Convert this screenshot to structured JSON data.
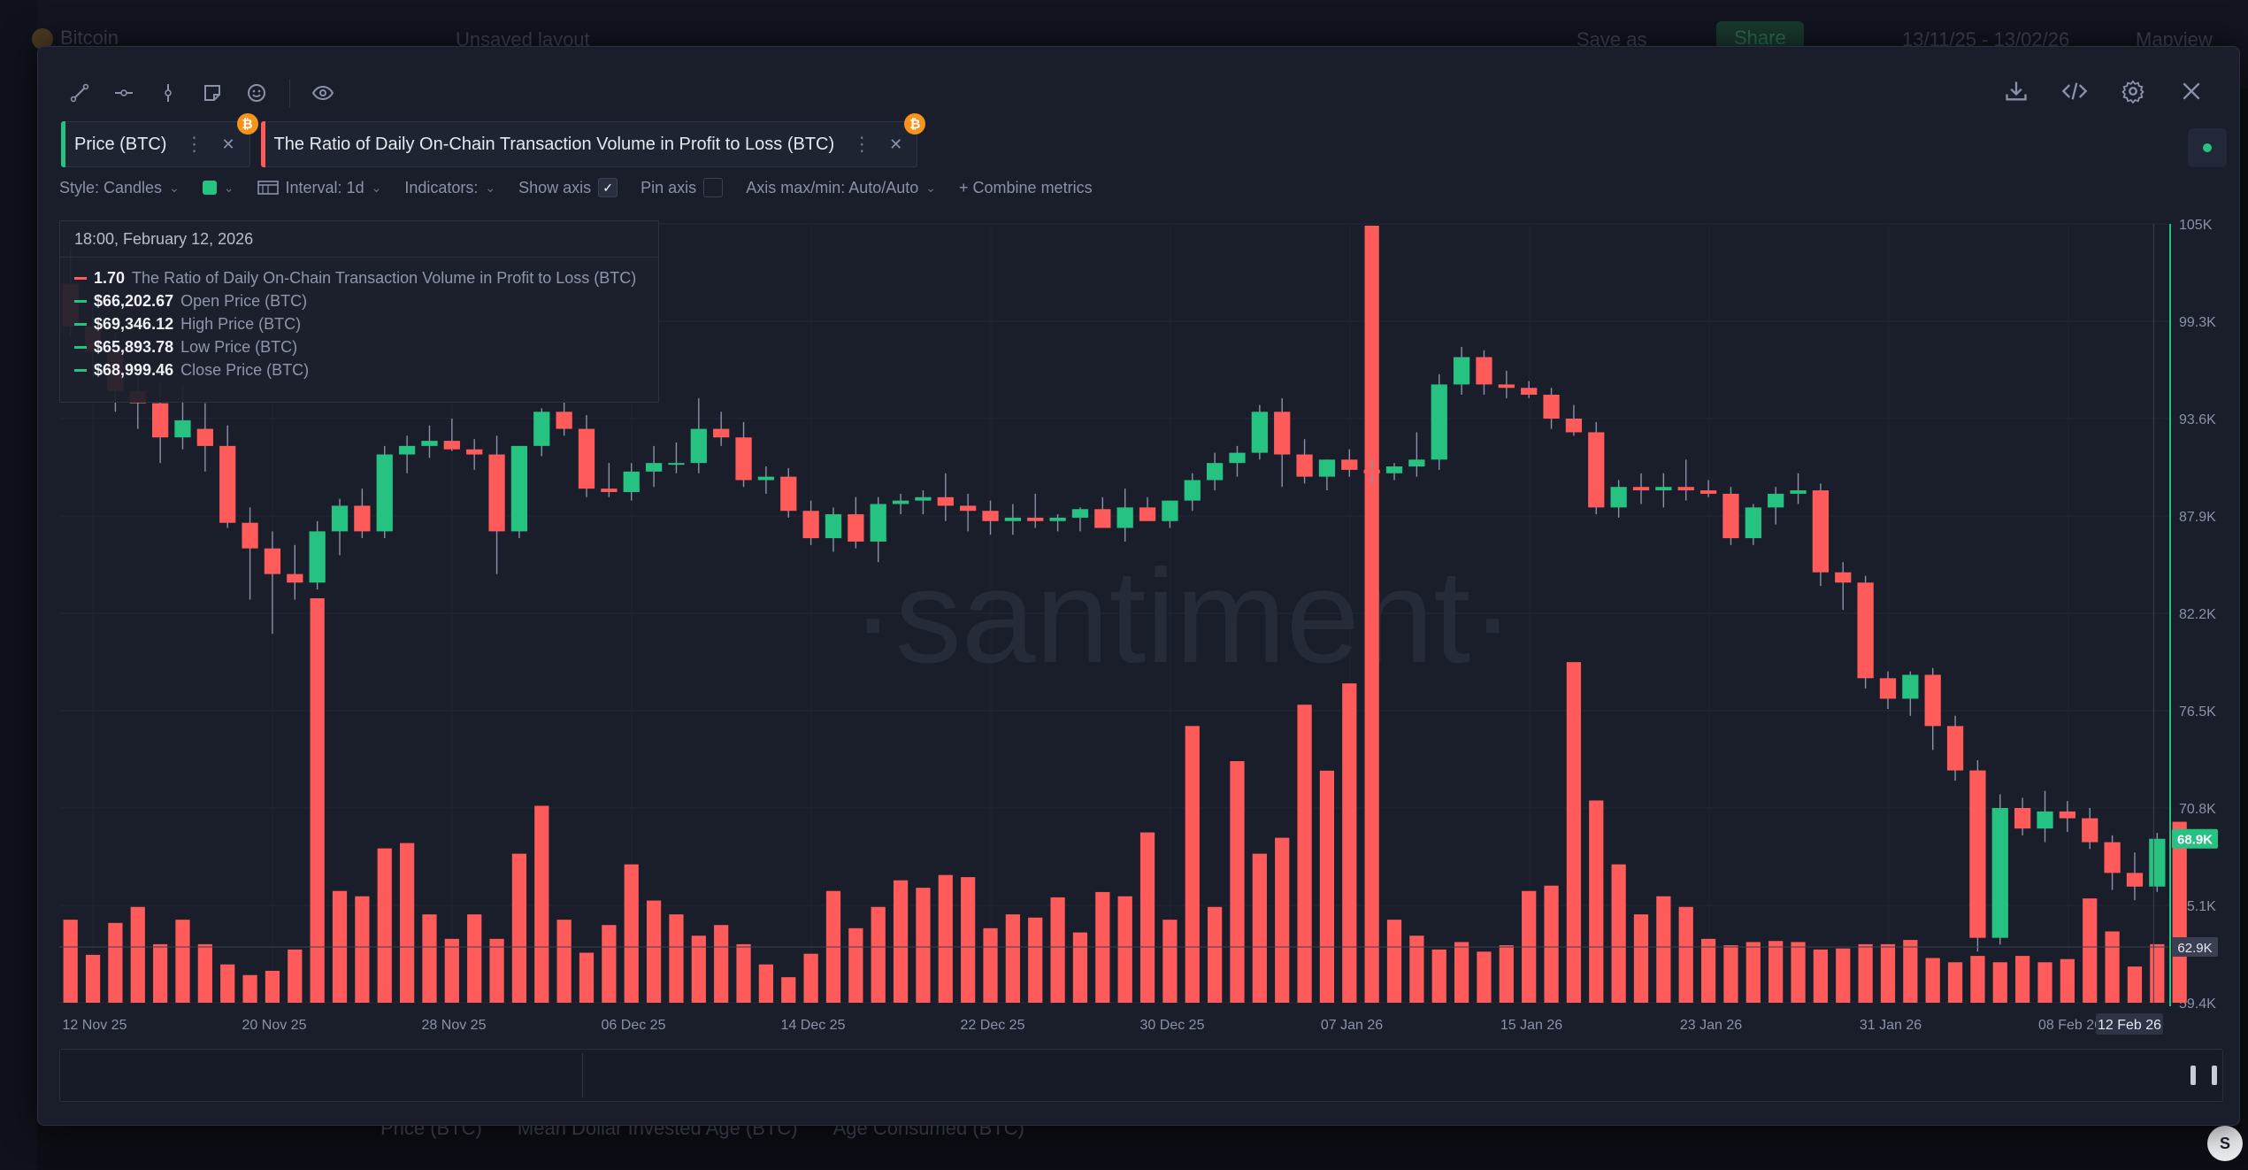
{
  "background": {
    "asset": "Bitcoin",
    "layout_title": "Unsaved layout",
    "save_as": "Save as",
    "share": "Share",
    "date_range": "13/11/25 - 13/02/26",
    "mapview": "Mapview",
    "bottom_tabs": [
      "Price (BTC)",
      "Mean Dollar Invested Age (BTC)",
      "Age Consumed (BTC)"
    ]
  },
  "toolbar": {
    "left_icons": [
      "trendline-icon",
      "horizontal-line-icon",
      "vertical-line-icon",
      "note-icon",
      "emoji-icon",
      "eye-icon"
    ],
    "right_icons": [
      "download-icon",
      "embed-code-icon",
      "settings-icon",
      "close-icon"
    ]
  },
  "metrics": [
    {
      "label": "Price (BTC)",
      "color": "#26c281"
    },
    {
      "label": "The Ratio of Daily On-Chain Transaction Volume in Profit to Loss (BTC)",
      "color": "#ff5b5b"
    }
  ],
  "settings": {
    "style": "Style: Candles",
    "interval": "Interval: 1d",
    "indicators": "Indicators:",
    "show_axis": "Show axis",
    "show_axis_checked": true,
    "pin_axis": "Pin axis",
    "pin_axis_checked": false,
    "axis_maxmin": "Axis max/min: Auto/Auto",
    "combine": "+ Combine metrics"
  },
  "tooltip": {
    "date": "18:00, February 12, 2026",
    "rows": [
      {
        "value": "1.70",
        "label": "The Ratio of Daily On-Chain Transaction Volume in Profit to Loss (BTC)",
        "color": "#ff5b5b"
      },
      {
        "value": "$66,202.67",
        "label": "Open Price (BTC)",
        "color": "#26c281"
      },
      {
        "value": "$69,346.12",
        "label": "High Price (BTC)",
        "color": "#26c281"
      },
      {
        "value": "$65,893.78",
        "label": "Low Price (BTC)",
        "color": "#26c281"
      },
      {
        "value": "$68,999.46",
        "label": "Close Price (BTC)",
        "color": "#26c281"
      }
    ]
  },
  "watermark": "·santiment·",
  "chart_data": {
    "type": "candlestick+bar",
    "y_ticks": [
      "105K",
      "99.3K",
      "93.6K",
      "87.9K",
      "82.2K",
      "76.5K",
      "70.8K",
      "65.1K",
      "59.4K"
    ],
    "y_range": [
      59400,
      105000
    ],
    "current_price_label": "68.9K",
    "ratio_marker_label": "62.9K",
    "x_ticks": [
      "12 Nov 25",
      "20 Nov 25",
      "28 Nov 25",
      "06 Dec 25",
      "14 Dec 25",
      "22 Dec 25",
      "30 Dec 25",
      "07 Jan 26",
      "15 Jan 26",
      "23 Jan 26",
      "31 Jan 26",
      "08 Feb 26",
      "12 Feb 26"
    ],
    "colors": {
      "up": "#26c281",
      "down": "#ff5b5b",
      "ratio": "#ff5b5b"
    },
    "candles": [
      {
        "o": 101500,
        "h": 103500,
        "l": 98400,
        "c": 99000
      },
      {
        "o": 99000,
        "h": 100200,
        "l": 96000,
        "c": 97500
      },
      {
        "o": 97500,
        "h": 98600,
        "l": 94000,
        "c": 95200
      },
      {
        "o": 95200,
        "h": 96500,
        "l": 93000,
        "c": 94500
      },
      {
        "o": 94500,
        "h": 95800,
        "l": 91000,
        "c": 92500
      },
      {
        "o": 92500,
        "h": 95500,
        "l": 91800,
        "c": 93500
      },
      {
        "o": 93000,
        "h": 94500,
        "l": 90500,
        "c": 92000
      },
      {
        "o": 92000,
        "h": 93200,
        "l": 87200,
        "c": 87500
      },
      {
        "o": 87500,
        "h": 88400,
        "l": 83000,
        "c": 86000
      },
      {
        "o": 86000,
        "h": 87000,
        "l": 81000,
        "c": 84500
      },
      {
        "o": 84500,
        "h": 86200,
        "l": 83000,
        "c": 84000
      },
      {
        "o": 84000,
        "h": 87600,
        "l": 83600,
        "c": 87000
      },
      {
        "o": 87000,
        "h": 88900,
        "l": 85600,
        "c": 88500
      },
      {
        "o": 88500,
        "h": 89500,
        "l": 86600,
        "c": 87000
      },
      {
        "o": 87000,
        "h": 92000,
        "l": 86600,
        "c": 91500
      },
      {
        "o": 91500,
        "h": 92600,
        "l": 90400,
        "c": 92000
      },
      {
        "o": 92000,
        "h": 93200,
        "l": 91300,
        "c": 92300
      },
      {
        "o": 92300,
        "h": 93600,
        "l": 91700,
        "c": 91800
      },
      {
        "o": 91800,
        "h": 92400,
        "l": 90600,
        "c": 91500
      },
      {
        "o": 91500,
        "h": 92600,
        "l": 84500,
        "c": 87000
      },
      {
        "o": 87000,
        "h": 92000,
        "l": 86600,
        "c": 92000
      },
      {
        "o": 92000,
        "h": 94200,
        "l": 91400,
        "c": 94000
      },
      {
        "o": 94000,
        "h": 94800,
        "l": 92600,
        "c": 93000
      },
      {
        "o": 93000,
        "h": 93800,
        "l": 89000,
        "c": 89500
      },
      {
        "o": 89500,
        "h": 91000,
        "l": 89000,
        "c": 89300
      },
      {
        "o": 89300,
        "h": 91000,
        "l": 88800,
        "c": 90500
      },
      {
        "o": 90500,
        "h": 92000,
        "l": 89600,
        "c": 91000
      },
      {
        "o": 91000,
        "h": 92200,
        "l": 90400,
        "c": 91000
      },
      {
        "o": 91000,
        "h": 94800,
        "l": 90400,
        "c": 93000
      },
      {
        "o": 93000,
        "h": 94000,
        "l": 92000,
        "c": 92500
      },
      {
        "o": 92500,
        "h": 93400,
        "l": 89600,
        "c": 90000
      },
      {
        "o": 90000,
        "h": 90800,
        "l": 89200,
        "c": 90200
      },
      {
        "o": 90200,
        "h": 90700,
        "l": 87800,
        "c": 88200
      },
      {
        "o": 88200,
        "h": 88800,
        "l": 86200,
        "c": 86600
      },
      {
        "o": 86600,
        "h": 88400,
        "l": 85800,
        "c": 88000
      },
      {
        "o": 88000,
        "h": 89000,
        "l": 86000,
        "c": 86400
      },
      {
        "o": 86400,
        "h": 89000,
        "l": 85200,
        "c": 88600
      },
      {
        "o": 88600,
        "h": 89200,
        "l": 88000,
        "c": 88800
      },
      {
        "o": 88800,
        "h": 89400,
        "l": 88000,
        "c": 89000
      },
      {
        "o": 89000,
        "h": 90400,
        "l": 87600,
        "c": 88500
      },
      {
        "o": 88500,
        "h": 89200,
        "l": 87000,
        "c": 88200
      },
      {
        "o": 88200,
        "h": 88800,
        "l": 86800,
        "c": 87600
      },
      {
        "o": 87600,
        "h": 88600,
        "l": 86800,
        "c": 87800
      },
      {
        "o": 87800,
        "h": 89200,
        "l": 87200,
        "c": 87600
      },
      {
        "o": 87600,
        "h": 88000,
        "l": 87000,
        "c": 87800
      },
      {
        "o": 87800,
        "h": 88400,
        "l": 87000,
        "c": 88300
      },
      {
        "o": 88300,
        "h": 89000,
        "l": 87400,
        "c": 87200
      },
      {
        "o": 87200,
        "h": 89500,
        "l": 86400,
        "c": 88400
      },
      {
        "o": 88400,
        "h": 89000,
        "l": 87800,
        "c": 87600
      },
      {
        "o": 87600,
        "h": 88800,
        "l": 87200,
        "c": 88800
      },
      {
        "o": 88800,
        "h": 90400,
        "l": 88200,
        "c": 90000
      },
      {
        "o": 90000,
        "h": 91600,
        "l": 89400,
        "c": 91000
      },
      {
        "o": 91000,
        "h": 92000,
        "l": 90200,
        "c": 91600
      },
      {
        "o": 91600,
        "h": 94400,
        "l": 91200,
        "c": 94000
      },
      {
        "o": 94000,
        "h": 94800,
        "l": 89600,
        "c": 91500
      },
      {
        "o": 91500,
        "h": 92400,
        "l": 89800,
        "c": 90200
      },
      {
        "o": 90200,
        "h": 91200,
        "l": 89400,
        "c": 91200
      },
      {
        "o": 91200,
        "h": 91800,
        "l": 90200,
        "c": 90600
      },
      {
        "o": 90600,
        "h": 91200,
        "l": 89800,
        "c": 90400
      },
      {
        "o": 90400,
        "h": 91000,
        "l": 90000,
        "c": 90800
      },
      {
        "o": 90800,
        "h": 92800,
        "l": 90200,
        "c": 91200
      },
      {
        "o": 91200,
        "h": 96200,
        "l": 90600,
        "c": 95600
      },
      {
        "o": 95600,
        "h": 97800,
        "l": 95000,
        "c": 97200
      },
      {
        "o": 97200,
        "h": 97600,
        "l": 95000,
        "c": 95600
      },
      {
        "o": 95600,
        "h": 96400,
        "l": 94800,
        "c": 95400
      },
      {
        "o": 95400,
        "h": 95800,
        "l": 94800,
        "c": 95000
      },
      {
        "o": 95000,
        "h": 95400,
        "l": 93000,
        "c": 93600
      },
      {
        "o": 93600,
        "h": 94400,
        "l": 92600,
        "c": 92800
      },
      {
        "o": 92800,
        "h": 93400,
        "l": 88000,
        "c": 88400
      },
      {
        "o": 88400,
        "h": 90000,
        "l": 87800,
        "c": 89600
      },
      {
        "o": 89600,
        "h": 90400,
        "l": 88600,
        "c": 89400
      },
      {
        "o": 89400,
        "h": 90400,
        "l": 88400,
        "c": 89600
      },
      {
        "o": 89600,
        "h": 91200,
        "l": 88800,
        "c": 89400
      },
      {
        "o": 89400,
        "h": 90000,
        "l": 89000,
        "c": 89200
      },
      {
        "o": 89200,
        "h": 89600,
        "l": 86200,
        "c": 86600
      },
      {
        "o": 86600,
        "h": 88600,
        "l": 86200,
        "c": 88400
      },
      {
        "o": 88400,
        "h": 89600,
        "l": 87400,
        "c": 89200
      },
      {
        "o": 89200,
        "h": 90400,
        "l": 88600,
        "c": 89400
      },
      {
        "o": 89400,
        "h": 89800,
        "l": 83800,
        "c": 84600
      },
      {
        "o": 84600,
        "h": 85200,
        "l": 82400,
        "c": 84000
      },
      {
        "o": 84000,
        "h": 84400,
        "l": 77800,
        "c": 78400
      },
      {
        "o": 78400,
        "h": 78800,
        "l": 76600,
        "c": 77200
      },
      {
        "o": 77200,
        "h": 78800,
        "l": 76200,
        "c": 78600
      },
      {
        "o": 78600,
        "h": 79000,
        "l": 74200,
        "c": 75600
      },
      {
        "o": 75600,
        "h": 76200,
        "l": 72400,
        "c": 73000
      },
      {
        "o": 73000,
        "h": 73600,
        "l": 62400,
        "c": 63200
      },
      {
        "o": 63200,
        "h": 71600,
        "l": 62800,
        "c": 70800
      },
      {
        "o": 70800,
        "h": 71400,
        "l": 69200,
        "c": 69600
      },
      {
        "o": 69600,
        "h": 71800,
        "l": 68800,
        "c": 70600
      },
      {
        "o": 70600,
        "h": 71200,
        "l": 69400,
        "c": 70200
      },
      {
        "o": 70200,
        "h": 70800,
        "l": 68400,
        "c": 68800
      },
      {
        "o": 68800,
        "h": 69200,
        "l": 66000,
        "c": 67000
      },
      {
        "o": 67000,
        "h": 68200,
        "l": 65400,
        "c": 66200
      },
      {
        "o": 66202.67,
        "h": 69346.12,
        "l": 65893.78,
        "c": 68999.46
      }
    ],
    "ratio": [
      0.78,
      0.45,
      0.75,
      0.9,
      0.55,
      0.78,
      0.55,
      0.36,
      0.26,
      0.3,
      0.5,
      3.8,
      1.05,
      1.0,
      1.45,
      1.5,
      0.83,
      0.6,
      0.83,
      0.6,
      1.4,
      1.85,
      0.78,
      0.47,
      0.73,
      1.3,
      0.96,
      0.83,
      0.63,
      0.73,
      0.55,
      0.36,
      0.24,
      0.46,
      1.05,
      0.7,
      0.9,
      1.15,
      1.08,
      1.2,
      1.18,
      0.7,
      0.83,
      0.8,
      0.99,
      0.66,
      1.04,
      1.0,
      1.6,
      0.78,
      2.6,
      0.9,
      2.27,
      1.4,
      1.55,
      2.8,
      2.18,
      3.0,
      7.3,
      0.78,
      0.63,
      0.5,
      0.57,
      0.48,
      0.54,
      1.05,
      1.1,
      3.2,
      1.9,
      1.3,
      0.83,
      1.0,
      0.9,
      0.6,
      0.54,
      0.57,
      0.58,
      0.57,
      0.5,
      0.51,
      0.55,
      0.55,
      0.59,
      0.42,
      0.38,
      0.44,
      0.38,
      0.44,
      0.38,
      0.41,
      0.98,
      0.67,
      0.34,
      0.55,
      1.7
    ],
    "ratio_range": [
      0,
      7.4
    ]
  }
}
